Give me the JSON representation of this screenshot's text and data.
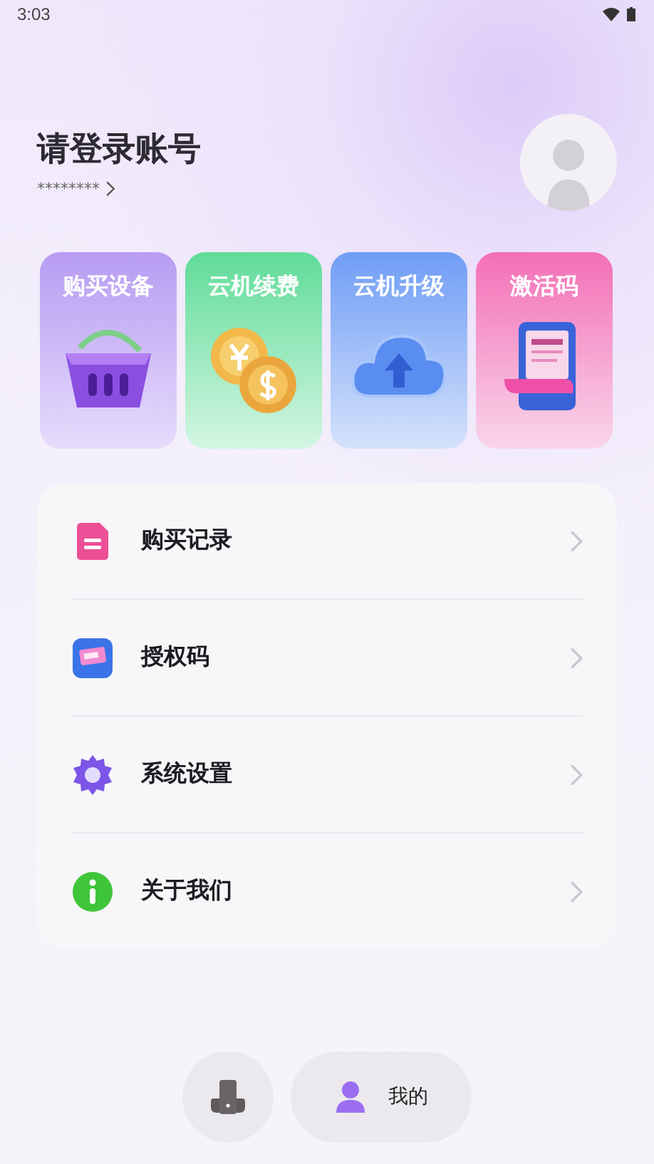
{
  "status_bar": {
    "time": "3:03"
  },
  "account": {
    "title": "请登录账号",
    "masked_id": "********"
  },
  "tiles": [
    {
      "label": "购买设备",
      "kind": "basket"
    },
    {
      "label": "云机续费",
      "kind": "coins"
    },
    {
      "label": "云机升级",
      "kind": "cloud"
    },
    {
      "label": "激活码",
      "kind": "receipt"
    }
  ],
  "menu": [
    {
      "label": "购买记录",
      "kind": "record"
    },
    {
      "label": "授权码",
      "kind": "ticket"
    },
    {
      "label": "系统设置",
      "kind": "settings"
    },
    {
      "label": "关于我们",
      "kind": "info"
    }
  ],
  "bottom_nav": [
    {
      "kind": "phone",
      "selected": false
    },
    {
      "kind": "profile",
      "label": "我的",
      "selected": true
    }
  ]
}
